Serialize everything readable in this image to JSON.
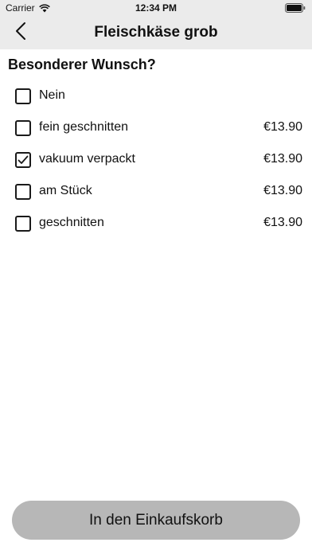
{
  "status_bar": {
    "carrier": "Carrier",
    "time": "12:34 PM"
  },
  "nav": {
    "title": "Fleischkäse grob",
    "back_icon": "chevron-left-icon"
  },
  "section": {
    "heading": "Besonderer Wunsch?"
  },
  "options": [
    {
      "label": "Nein",
      "price": "",
      "checked": false
    },
    {
      "label": "fein geschnitten",
      "price": "€13.90",
      "checked": false
    },
    {
      "label": "vakuum verpackt",
      "price": "€13.90",
      "checked": true
    },
    {
      "label": "am Stück",
      "price": "€13.90",
      "checked": false
    },
    {
      "label": "geschnitten",
      "price": "€13.90",
      "checked": false
    }
  ],
  "footer": {
    "cart_button_label": "In den Einkaufskorb"
  },
  "colors": {
    "bar_background": "#ebebeb",
    "button_background": "#b7b7b7",
    "text": "#111111"
  }
}
